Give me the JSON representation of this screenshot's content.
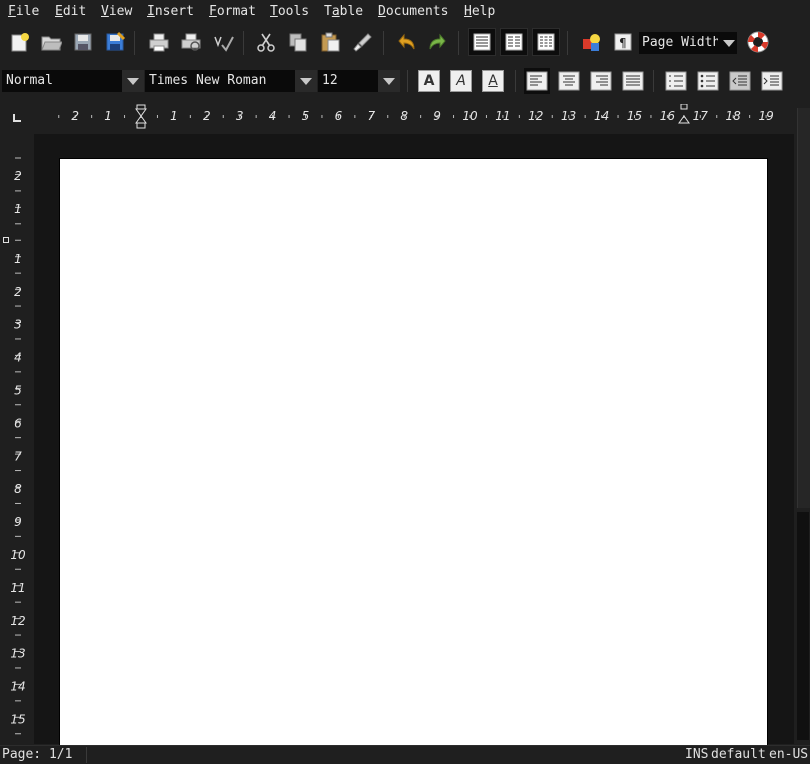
{
  "menu": [
    {
      "label": "File",
      "key": "F",
      "rest": "ile"
    },
    {
      "label": "Edit",
      "key": "E",
      "rest": "dit"
    },
    {
      "label": "View",
      "key": "V",
      "rest": "iew"
    },
    {
      "label": "Insert",
      "key": "I",
      "rest": "nsert"
    },
    {
      "label": "Format",
      "key": "F",
      "rest": "ormat"
    },
    {
      "label": "Tools",
      "key": "T",
      "rest": "ools"
    },
    {
      "label": "Table",
      "pre": "T",
      "key": "a",
      "rest": "ble"
    },
    {
      "label": "Documents",
      "key": "D",
      "rest": "ocuments"
    },
    {
      "label": "Help",
      "key": "H",
      "rest": "elp"
    }
  ],
  "toolbar": {
    "zoom_value": "Page Width"
  },
  "format_bar": {
    "style_value": "Normal",
    "font_value": "Times New Roman",
    "size_value": "12",
    "bold_glyph": "A",
    "italic_glyph": "A",
    "underline_glyph": "A"
  },
  "rulers": {
    "horizontal_labels": [
      "2",
      "1",
      "1",
      "2",
      "3",
      "4",
      "5",
      "6",
      "7",
      "8",
      "9",
      "10",
      "11",
      "12",
      "13",
      "14",
      "15",
      "16",
      "17",
      "18",
      "19"
    ],
    "vertical_labels": [
      "2",
      "1",
      "1",
      "2",
      "3",
      "4",
      "5",
      "6",
      "7",
      "8",
      "9",
      "10",
      "11",
      "12",
      "13",
      "14",
      "15"
    ]
  },
  "status": {
    "page": "Page: 1/1",
    "mode": "INS",
    "style": "default",
    "language": "en-US"
  },
  "colors": {
    "background": "#1f1f1f",
    "page": "#ffffff",
    "accent_save": "#3b7dd8",
    "undo_redo": "#e0a020",
    "help_ring": "#d93a2a"
  }
}
